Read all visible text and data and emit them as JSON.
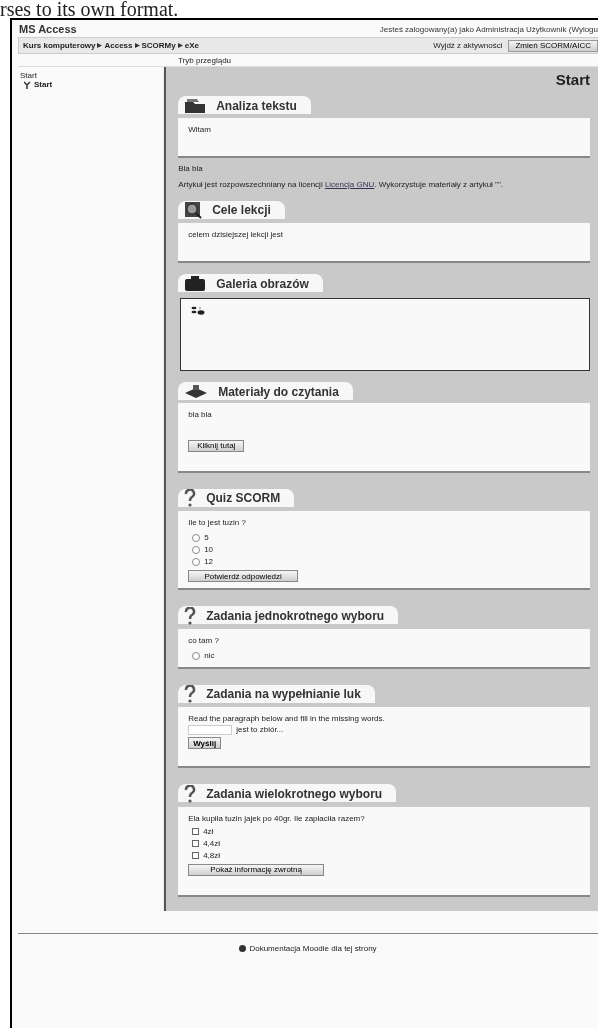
{
  "print_text": "rses to its own format.",
  "header": {
    "site_title": "MS Access",
    "login_text": "Jesteś zalogowany(a) jako Administracja Użytkownik (Wylogu"
  },
  "breadcrumb": [
    "Kurs komputerowy",
    "Access",
    "SCORMy",
    "eXe"
  ],
  "nav_actions": {
    "exit_link": "Wyjdź z aktywności",
    "change_button": "Zmień SCORM/AICC"
  },
  "mode_label": "Tryb przeglądu",
  "toc": {
    "heading": "Start",
    "items": [
      {
        "label": "Start",
        "selected": true
      }
    ]
  },
  "content": {
    "title": "Start",
    "sections": [
      {
        "kind": "text",
        "title": "Analiza tekstu",
        "body": "Witam"
      },
      {
        "kind": "note",
        "title": "Bla bla",
        "license": {
          "before": "Artykuł jest rozpowszechniany na licencji ",
          "link": "Licencja GNU",
          "after": ". Wykorzystuje materiały z artykuł \"\"."
        }
      },
      {
        "kind": "goals",
        "title": "Cele lekcji",
        "body": "celem dzisiejszej lekcji jest"
      },
      {
        "kind": "gallery",
        "title": "Galeria obrazów"
      },
      {
        "kind": "reading",
        "title": "Materiały do czytania",
        "body": "bla bla",
        "button": "Kliknij tutaj"
      },
      {
        "kind": "quiz",
        "title": "Quiz SCORM",
        "question": "Ile to jest tuzin ?",
        "options": [
          {
            "label": "5",
            "selected": false
          },
          {
            "label": "10",
            "selected": false
          },
          {
            "label": "12",
            "selected": false
          }
        ],
        "button": "Potwierdź odpowiedzi"
      },
      {
        "kind": "single",
        "title": "Zadania jednokrotnego wyboru",
        "question": "co tam ?",
        "options": [
          {
            "label": "nic",
            "selected": false
          }
        ]
      },
      {
        "kind": "fill",
        "title": "Zadania na wypełnianie luk",
        "instruction": "Read the paragraph below and fill in the missing words.",
        "after_gap": "jest to zbiór...",
        "button": "Wyślij"
      },
      {
        "kind": "multi",
        "title": "Zadania wielokrotnego wyboru",
        "question": "Ela kupiła tuzin jajek po 40gr. Ile zapłaciła razem?",
        "options": [
          {
            "label": "4zł",
            "checked": false
          },
          {
            "label": "4,4zł",
            "checked": false
          },
          {
            "label": "4,8zł",
            "checked": false
          }
        ],
        "button": "Pokaż informację zwrotną"
      }
    ]
  },
  "footer": {
    "docs_link": "Dokumentacja Moodle dla tej strony"
  }
}
